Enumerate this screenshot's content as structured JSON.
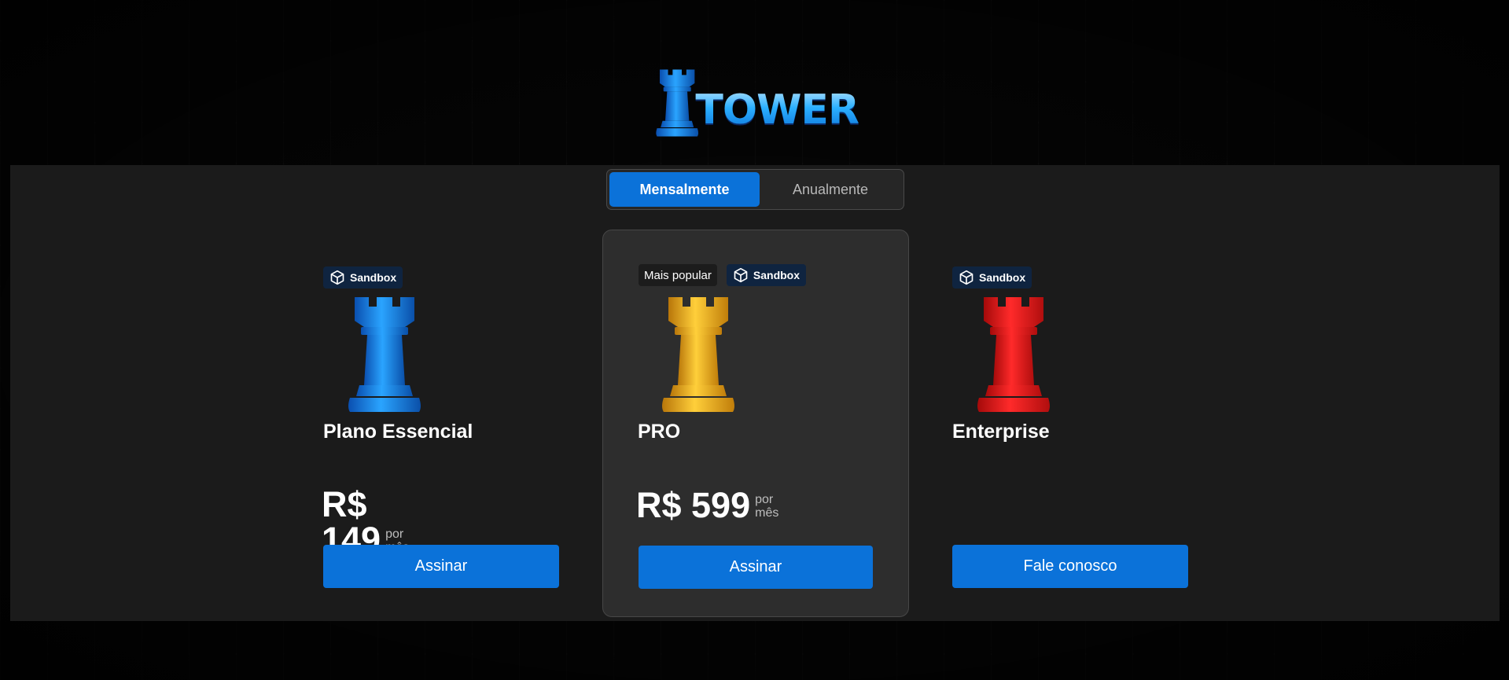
{
  "brand": {
    "logo_text": "TOWER",
    "accent": "#0b72d9"
  },
  "billing_toggle": {
    "options": [
      {
        "label": "Mensalmente",
        "active": true
      },
      {
        "label": "Anualmente",
        "active": false
      }
    ]
  },
  "plans": [
    {
      "badges": {
        "popular": null,
        "sandbox": "Sandbox"
      },
      "piece_color": "blue",
      "name": "Plano Essencial",
      "price": "R$ 149",
      "per_1": "por",
      "per_2": "mês",
      "cta": "Assinar"
    },
    {
      "badges": {
        "popular": "Mais popular",
        "sandbox": "Sandbox"
      },
      "piece_color": "gold",
      "name": "PRO",
      "price": "R$ 599",
      "per_1": "por",
      "per_2": "mês",
      "cta": "Assinar",
      "highlighted": true
    },
    {
      "badges": {
        "popular": null,
        "sandbox": "Sandbox"
      },
      "piece_color": "red",
      "name": "Enterprise",
      "price": "",
      "cta": "Fale conosco"
    }
  ],
  "icons": {
    "sandbox": "cube-icon",
    "plan": "rook-piece-icon"
  }
}
